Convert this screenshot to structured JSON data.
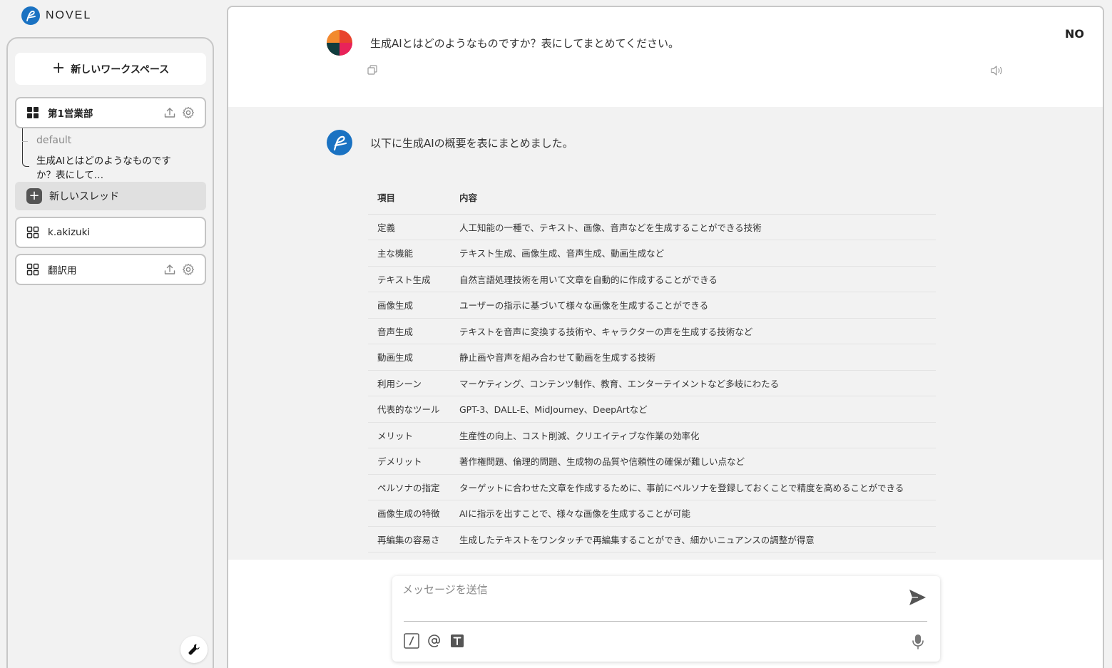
{
  "app": {
    "logo_text": "NOVEL",
    "brand_color": "#1a72c2",
    "user_initials": "NO"
  },
  "sidebar": {
    "new_workspace_label": "新しいワークスペース",
    "workspaces": [
      {
        "name": "第1営業部",
        "icon": "grid-filled-icon",
        "active": true
      },
      {
        "name": "k.akizuki",
        "icon": "grid-outline-icon",
        "active": false
      },
      {
        "name": "翻訳用",
        "icon": "grid-outline-icon",
        "active": false
      }
    ],
    "threads": {
      "default_label": "default",
      "items": [
        "生成AIとはどのようなものですか？表にして…"
      ]
    },
    "new_thread_label": "新しいスレッド"
  },
  "chat": {
    "user_message": "生成AIとはどのようなものですか？表にしてまとめてください。",
    "bot_intro": "以下に生成AIの概要を表にまとめました。",
    "table": {
      "headers": [
        "項目",
        "内容"
      ],
      "rows": [
        [
          "定義",
          "人工知能の一種で、テキスト、画像、音声などを生成することができる技術"
        ],
        [
          "主な機能",
          "テキスト生成、画像生成、音声生成、動画生成など"
        ],
        [
          "テキスト生成",
          "自然言語処理技術を用いて文章を自動的に作成することができる"
        ],
        [
          "画像生成",
          "ユーザーの指示に基づいて様々な画像を生成することができる"
        ],
        [
          "音声生成",
          "テキストを音声に変換する技術や、キャラクターの声を生成する技術など"
        ],
        [
          "動画生成",
          "静止画や音声を組み合わせて動画を生成する技術"
        ],
        [
          "利用シーン",
          "マーケティング、コンテンツ制作、教育、エンターテイメントなど多岐にわたる"
        ],
        [
          "代表的なツール",
          "GPT-3、DALL-E、MidJourney、DeepArtなど"
        ],
        [
          "メリット",
          "生産性の向上、コスト削減、クリエイティブな作業の効率化"
        ],
        [
          "デメリット",
          "著作権問題、倫理的問題、生成物の品質や信頼性の確保が難しい点など"
        ],
        [
          "ペルソナの指定",
          "ターゲットに合わせた文章を作成するために、事前にペルソナを登録しておくことで精度を高めることができる"
        ],
        [
          "画像生成の特徴",
          "AIに指示を出すことで、様々な画像を生成することが可能"
        ],
        [
          "再編集の容易さ",
          "生成したテキストをワンタッチで再編集することができ、細かいニュアンスの調整が得意"
        ]
      ]
    }
  },
  "composer": {
    "placeholder": "メッセージを送信",
    "value": ""
  }
}
